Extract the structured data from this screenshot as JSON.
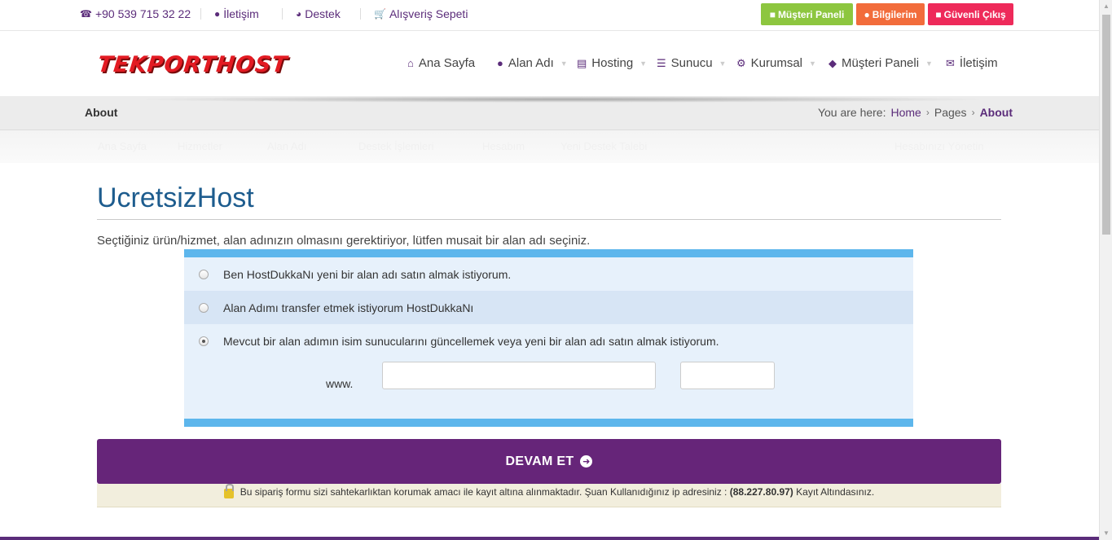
{
  "topbar": {
    "phone": "+90 539 715 32 22",
    "contact": "İletişim",
    "support": "Destek",
    "cart": "Alışveriş Sepeti",
    "buttons": {
      "panel": "Müşteri Paneli",
      "info": "Bilgilerim",
      "logout": "Güvenli Çıkış"
    },
    "colors": {
      "panel": "#8dc63f",
      "info": "#f26c3b",
      "logout": "#ee2a5a"
    }
  },
  "header": {
    "logo": "TEKPORTHOST",
    "nav": [
      "Ana Sayfa",
      "Alan Adı",
      "Hosting",
      "Sunucu",
      "Kurumsal",
      "Müşteri Paneli",
      "İletişim"
    ]
  },
  "breadcrumb": {
    "title": "About",
    "prefix": "You are here:",
    "items": [
      "Home",
      "Pages",
      "About"
    ]
  },
  "submenu": [
    "Ana Sayfa",
    "Hizmetler",
    "Alan Adı",
    "Destek İşlemleri",
    "Hesabım",
    "Yeni Destek Talebi",
    "Hesabınızı Yönetin"
  ],
  "main": {
    "title": "UcretsizHost",
    "lead": "Seçtiğiniz ürün/hizmet, alan adınızın olmasını gerektiriyor, lütfen musait bir alan adı seçiniz.",
    "options": [
      "Ben HostDukkaNı yeni bir alan adı satın almak istiyorum.",
      "Alan Adımı transfer etmek istiyorum HostDukkaNı",
      "Mevcut bir alan adımın isim sunucularını güncellemek veya yeni bir alan adı satın almak istiyorum."
    ],
    "selected_option": 2,
    "www_label": "www.",
    "domain_value": "",
    "tld_value": "",
    "continue_label": "DEVAM ET",
    "notice": "Bu sipariş formu sizi sahtekarlıktan korumak amacı ile kayıt altına alınmaktadır. Şuan Kullanıdığınız ip adresiniz :",
    "ip": "(88.227.80.97)",
    "notice_suffix": "Kayıt Altındasınız."
  },
  "colors": {
    "brand": "#662579",
    "accent_blue": "#5db6ec",
    "title_blue": "#1d5c8e"
  }
}
